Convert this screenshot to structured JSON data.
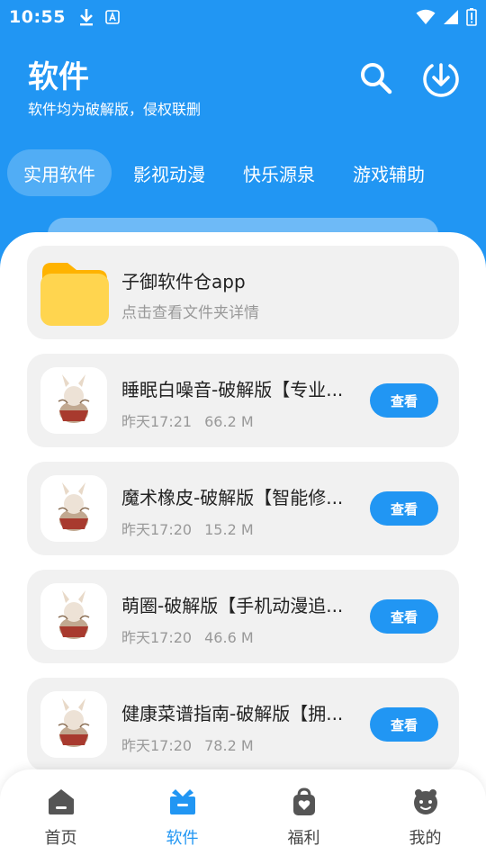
{
  "status_bar": {
    "time": "10:55"
  },
  "header": {
    "title": "软件",
    "subtitle": "软件均为破解版，侵权联删"
  },
  "tabs": [
    {
      "label": "实用软件",
      "active": true
    },
    {
      "label": "影视动漫",
      "active": false
    },
    {
      "label": "快乐源泉",
      "active": false
    },
    {
      "label": "游戏辅助",
      "active": false
    }
  ],
  "folder": {
    "title": "子御软件仓app",
    "subtitle": "点击查看文件夹详情"
  },
  "apps": [
    {
      "title": "睡眠白噪音-破解版【专业助眠】",
      "time": "昨天17:21",
      "size": "66.2 M",
      "button": "查看"
    },
    {
      "title": "魔术橡皮-破解版【智能修图】",
      "time": "昨天17:20",
      "size": "15.2 M",
      "button": "查看"
    },
    {
      "title": "萌圈-破解版【手机动漫追番】",
      "time": "昨天17:20",
      "size": "46.6 M",
      "button": "查看"
    },
    {
      "title": "健康菜谱指南-破解版【拥有海量菜谱】",
      "time": "昨天17:20",
      "size": "78.2 M",
      "button": "查看"
    }
  ],
  "bottom_nav": [
    {
      "label": "首页",
      "icon": "home-icon",
      "active": false
    },
    {
      "label": "软件",
      "icon": "software-icon",
      "active": true
    },
    {
      "label": "福利",
      "icon": "gift-bag-icon",
      "active": false
    },
    {
      "label": "我的",
      "icon": "profile-icon",
      "active": false
    }
  ],
  "colors": {
    "primary": "#2196F3",
    "card": "#f1f1f1",
    "folder": "#FFD54F"
  }
}
